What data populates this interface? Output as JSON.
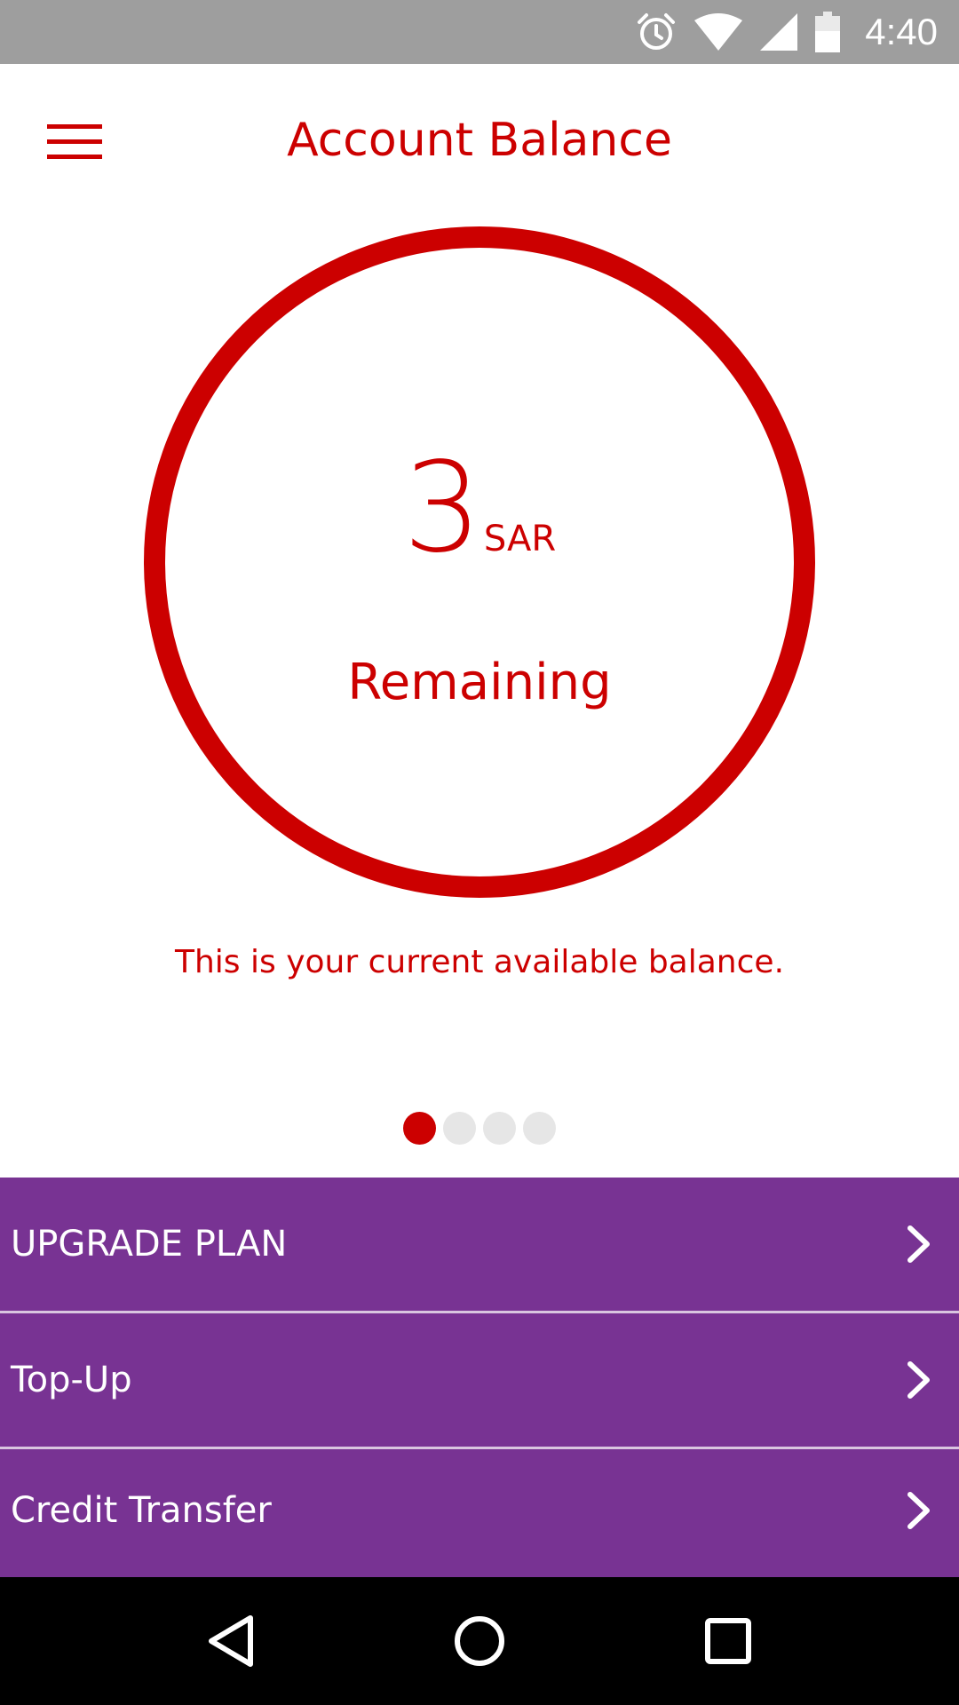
{
  "status_bar": {
    "time": "4:40",
    "icons": [
      "alarm-icon",
      "wifi-icon",
      "cell-signal-icon",
      "battery-icon"
    ]
  },
  "header": {
    "title": "Account Balance",
    "menu_icon": "hamburger-menu-icon"
  },
  "balance": {
    "amount": "3",
    "currency": "SAR",
    "label": "Remaining",
    "caption": "This is your current available balance."
  },
  "pager": {
    "count": 4,
    "active_index": 0
  },
  "actions": [
    {
      "label": "UPGRADE PLAN",
      "icon": "chevron-right-icon"
    },
    {
      "label": "Top-Up",
      "icon": "chevron-right-icon"
    },
    {
      "label": "Credit Transfer",
      "icon": "chevron-right-icon"
    }
  ],
  "nav_bar": {
    "buttons": [
      "back-icon",
      "home-icon",
      "recents-icon"
    ]
  },
  "colors": {
    "accent": "#cc0000",
    "action_bg": "#783393",
    "status_bar_bg": "#9e9e9e",
    "nav_bar_bg": "#000000"
  }
}
